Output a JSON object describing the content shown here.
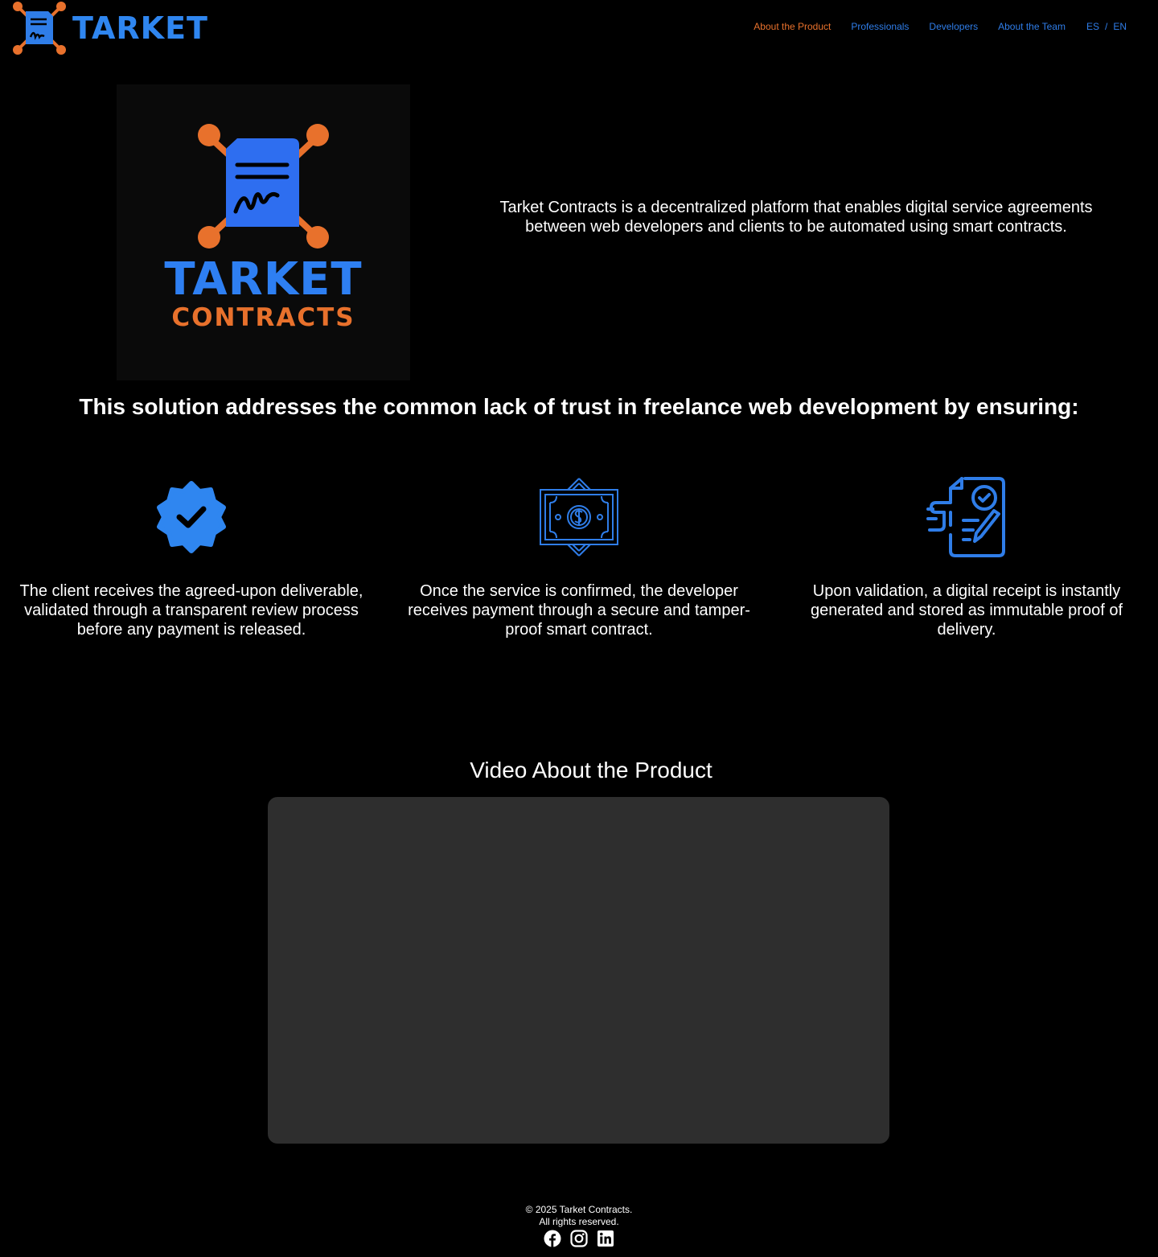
{
  "header": {
    "brand": "TARKET",
    "nav": [
      {
        "label": "About the Product",
        "active": true
      },
      {
        "label": "Professionals",
        "active": false
      },
      {
        "label": "Developers",
        "active": false
      },
      {
        "label": "About the Team",
        "active": false
      }
    ],
    "lang": {
      "es": "ES",
      "sep": "/",
      "en": "EN"
    }
  },
  "hero": {
    "logo_word1": "TARKET",
    "logo_word2": "CONTRACTS",
    "description": "Tarket Contracts is a decentralized platform that enables digital service agreements between web developers and clients to be automated using smart contracts."
  },
  "headline": "This solution addresses the common lack of trust in freelance web development by ensuring:",
  "features": [
    {
      "icon": "verified-badge-icon",
      "text": "The client receives the agreed-upon deliverable, validated through a transparent review process before any payment is released."
    },
    {
      "icon": "money-bill-icon",
      "text": "Once the service is confirmed, the developer receives payment through a secure and tamper-proof smart contract."
    },
    {
      "icon": "signed-receipt-icon",
      "text": "Upon validation, a digital receipt is instantly generated and stored as immutable proof of delivery."
    }
  ],
  "video": {
    "title": "Video About the Product"
  },
  "footer": {
    "copyright": "© 2025 Tarket Contracts.",
    "rights": "All rights reserved.",
    "socials": [
      "facebook-icon",
      "instagram-icon",
      "linkedin-icon"
    ]
  },
  "colors": {
    "accent_blue": "#2f86f0",
    "accent_orange": "#e8712c",
    "background": "#000000",
    "video_bg": "#2e2e2e"
  }
}
